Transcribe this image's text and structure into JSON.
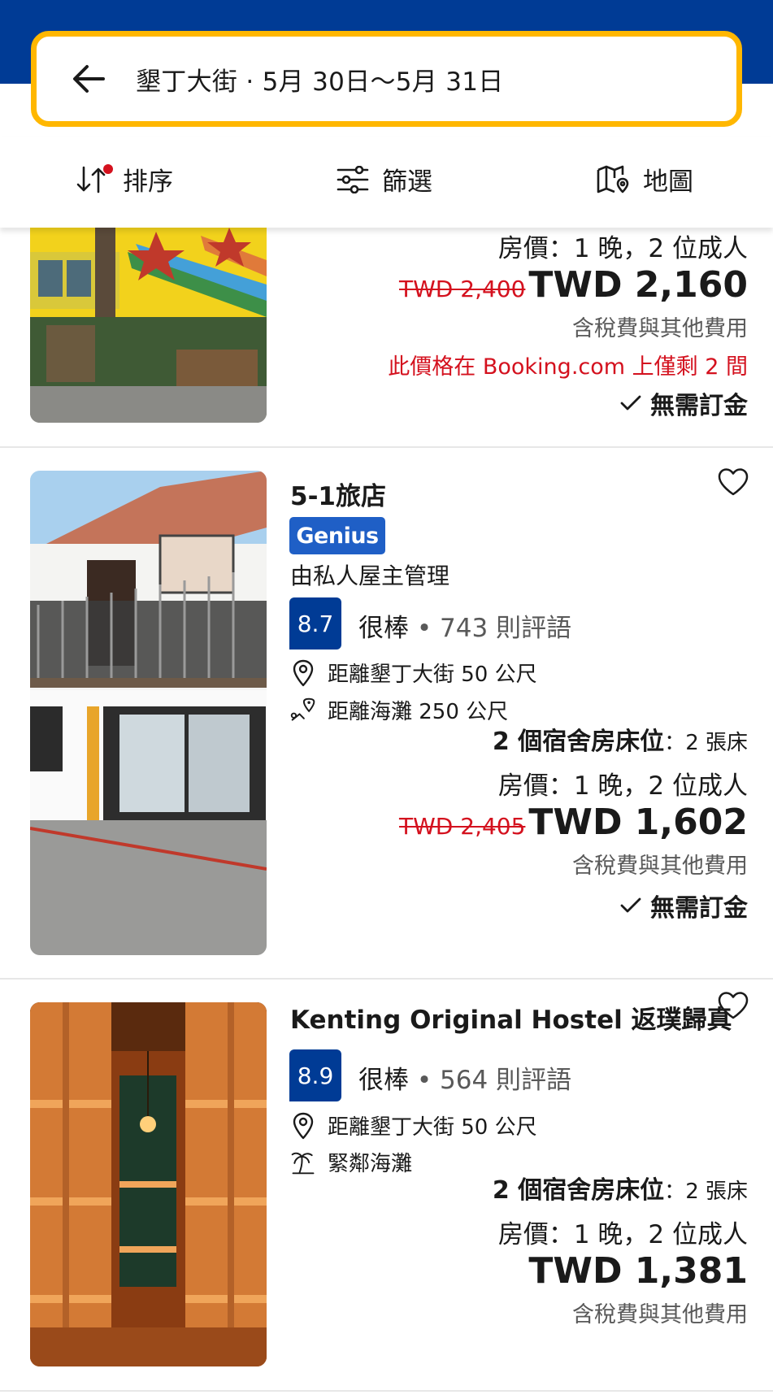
{
  "search": {
    "text": "墾丁大街 · 5月 30日～5月 31日"
  },
  "toolbar": {
    "sort": "排序",
    "filter": "篩選",
    "map": "地圖"
  },
  "listings": [
    {
      "occupancy": "房價：1 晚，2 位成人",
      "old_price": "TWD 2,400",
      "price": "TWD 2,160",
      "tax": "含稅費與其他費用",
      "scarcity": "此價格在 Booking.com 上僅剩 2 間",
      "no_deposit": "無需訂金"
    },
    {
      "name": "5-1旅店",
      "genius": "Genius",
      "managed": "由私人屋主管理",
      "score": "8.7",
      "rating_word": "很棒",
      "review_count": "743 則評語",
      "distance_center": "距離墾丁大街 50 公尺",
      "distance_beach": "距離海灘 250 公尺",
      "room_type": "2 個宿舍房床位",
      "beds": "2 張床",
      "occupancy": "房價：1 晚，2 位成人",
      "old_price": "TWD 2,405",
      "price": "TWD 1,602",
      "tax": "含稅費與其他費用",
      "no_deposit": "無需訂金"
    },
    {
      "name": "Kenting Original Hostel 返璞歸真",
      "score": "8.9",
      "rating_word": "很棒",
      "review_count": "564 則評語",
      "distance_center": "距離墾丁大街 50 公尺",
      "beach": "緊鄰海灘",
      "room_type": "2 個宿舍房床位",
      "beds": "2 張床",
      "occupancy": "房價：1 晚，2 位成人",
      "price": "TWD 1,381",
      "tax": "含稅費與其他費用"
    }
  ],
  "colors": {
    "brand_blue": "#003b95",
    "accent_yellow": "#ffb700",
    "discount_red": "#d4111e",
    "genius_blue": "#1f5fc6"
  }
}
